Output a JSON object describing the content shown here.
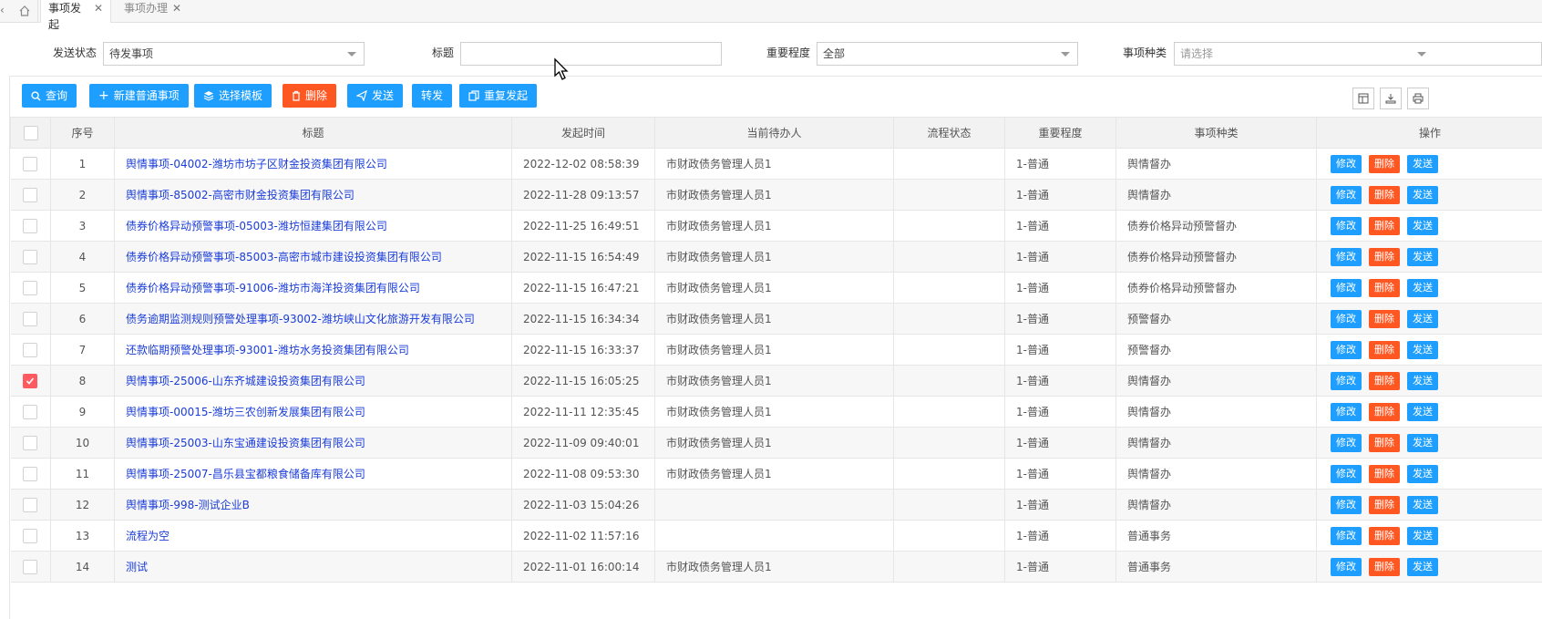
{
  "tabs": {
    "active": "事项发起",
    "inactive": "事项办理"
  },
  "search": {
    "status_label": "发送状态",
    "status_value": "待发事项",
    "title_label": "标题",
    "title_value": "",
    "importance_label": "重要程度",
    "importance_value": "全部",
    "category_label": "事项种类",
    "category_placeholder": "请选择"
  },
  "toolbar": {
    "query": "查询",
    "new_item": "新建普通事项",
    "select_template": "选择模板",
    "delete": "删除",
    "send": "发送",
    "forward": "转发",
    "resend": "重复发起"
  },
  "table": {
    "headers": [
      "序号",
      "标题",
      "发起时间",
      "当前待办人",
      "流程状态",
      "重要程度",
      "事项种类",
      "操作"
    ],
    "op_labels": {
      "edit": "修改",
      "delete": "删除",
      "send": "发送"
    },
    "rows": [
      {
        "no": "1",
        "title": "舆情事项-04002-潍坊市坊子区财金投资集团有限公司",
        "time": "2022-12-02 08:58:39",
        "assignee": "市财政债务管理人员1",
        "status": "",
        "importance": "1-普通",
        "category": "舆情督办",
        "checked": false
      },
      {
        "no": "2",
        "title": "舆情事项-85002-高密市财金投资集团有限公司",
        "time": "2022-11-28 09:13:57",
        "assignee": "市财政债务管理人员1",
        "status": "",
        "importance": "1-普通",
        "category": "舆情督办",
        "checked": false
      },
      {
        "no": "3",
        "title": "债券价格异动预警事项-05003-潍坊恒建集团有限公司",
        "time": "2022-11-25 16:49:51",
        "assignee": "市财政债务管理人员1",
        "status": "",
        "importance": "1-普通",
        "category": "债券价格异动预警督办",
        "checked": false
      },
      {
        "no": "4",
        "title": "债券价格异动预警事项-85003-高密市城市建设投资集团有限公司",
        "time": "2022-11-15 16:54:49",
        "assignee": "市财政债务管理人员1",
        "status": "",
        "importance": "1-普通",
        "category": "债券价格异动预警督办",
        "checked": false
      },
      {
        "no": "5",
        "title": "债券价格异动预警事项-91006-潍坊市海洋投资集团有限公司",
        "time": "2022-11-15 16:47:21",
        "assignee": "市财政债务管理人员1",
        "status": "",
        "importance": "1-普通",
        "category": "债券价格异动预警督办",
        "checked": false
      },
      {
        "no": "6",
        "title": "债务逾期监测规则预警处理事项-93002-潍坊峡山文化旅游开发有限公司",
        "time": "2022-11-15 16:34:34",
        "assignee": "市财政债务管理人员1",
        "status": "",
        "importance": "1-普通",
        "category": "预警督办",
        "checked": false
      },
      {
        "no": "7",
        "title": "还款临期预警处理事项-93001-潍坊水务投资集团有限公司",
        "time": "2022-11-15 16:33:37",
        "assignee": "市财政债务管理人员1",
        "status": "",
        "importance": "1-普通",
        "category": "预警督办",
        "checked": false
      },
      {
        "no": "8",
        "title": "舆情事项-25006-山东齐城建设投资集团有限公司",
        "time": "2022-11-15 16:05:25",
        "assignee": "市财政债务管理人员1",
        "status": "",
        "importance": "1-普通",
        "category": "舆情督办",
        "checked": true
      },
      {
        "no": "9",
        "title": "舆情事项-00015-潍坊三农创新发展集团有限公司",
        "time": "2022-11-11 12:35:45",
        "assignee": "市财政债务管理人员1",
        "status": "",
        "importance": "1-普通",
        "category": "舆情督办",
        "checked": false
      },
      {
        "no": "10",
        "title": "舆情事项-25003-山东宝通建设投资集团有限公司",
        "time": "2022-11-09 09:40:01",
        "assignee": "市财政债务管理人员1",
        "status": "",
        "importance": "1-普通",
        "category": "舆情督办",
        "checked": false
      },
      {
        "no": "11",
        "title": "舆情事项-25007-昌乐县宝都粮食储备库有限公司",
        "time": "2022-11-08 09:53:30",
        "assignee": "市财政债务管理人员1",
        "status": "",
        "importance": "1-普通",
        "category": "舆情督办",
        "checked": false
      },
      {
        "no": "12",
        "title": "舆情事项-998-测试企业B",
        "time": "2022-11-03 15:04:26",
        "assignee": "",
        "status": "",
        "importance": "1-普通",
        "category": "舆情督办",
        "checked": false
      },
      {
        "no": "13",
        "title": "流程为空",
        "time": "2022-11-02 11:57:16",
        "assignee": "",
        "status": "",
        "importance": "1-普通",
        "category": "普通事务",
        "checked": false
      },
      {
        "no": "14",
        "title": "测试",
        "time": "2022-11-01 16:00:14",
        "assignee": "市财政债务管理人员1",
        "status": "",
        "importance": "1-普通",
        "category": "普通事务",
        "checked": false
      }
    ]
  }
}
